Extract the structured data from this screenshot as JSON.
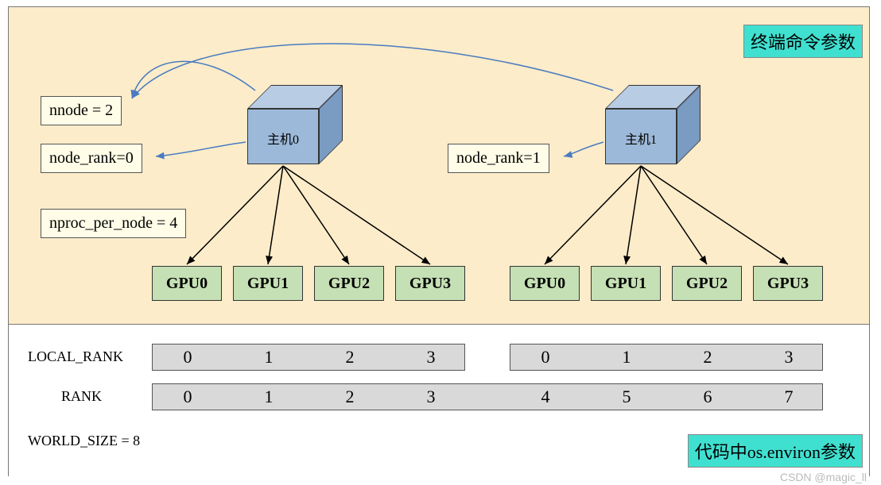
{
  "badges": {
    "top": "终端命令参数",
    "bottom": "代码中os.environ参数"
  },
  "params": {
    "nnode": "nnode = 2",
    "node_rank0": "node_rank=0",
    "nproc": "nproc_per_node = 4",
    "node_rank1": "node_rank=1"
  },
  "hosts": {
    "h0": "主机0",
    "h1": "主机1"
  },
  "gpus": {
    "left": [
      "GPU0",
      "GPU1",
      "GPU2",
      "GPU3"
    ],
    "right": [
      "GPU0",
      "GPU1",
      "GPU2",
      "GPU3"
    ]
  },
  "rows": {
    "local_rank_label": "LOCAL_RANK",
    "rank_label": "RANK",
    "world_size_label": "WORLD_SIZE = 8",
    "local_rank_left": [
      "0",
      "1",
      "2",
      "3"
    ],
    "local_rank_right": [
      "0",
      "1",
      "2",
      "3"
    ],
    "rank_vals": [
      "0",
      "1",
      "2",
      "3",
      "4",
      "5",
      "6",
      "7"
    ]
  },
  "watermark": "CSDN @magic_ll",
  "chart_data": {
    "type": "table",
    "title": "Distributed training rank mapping",
    "nnode": 2,
    "nproc_per_node": 4,
    "world_size": 8,
    "nodes": [
      {
        "name": "主机0",
        "node_rank": 0,
        "gpus": [
          "GPU0",
          "GPU1",
          "GPU2",
          "GPU3"
        ],
        "local_rank": [
          0,
          1,
          2,
          3
        ],
        "rank": [
          0,
          1,
          2,
          3
        ]
      },
      {
        "name": "主机1",
        "node_rank": 1,
        "gpus": [
          "GPU0",
          "GPU1",
          "GPU2",
          "GPU3"
        ],
        "local_rank": [
          0,
          1,
          2,
          3
        ],
        "rank": [
          4,
          5,
          6,
          7
        ]
      }
    ]
  }
}
